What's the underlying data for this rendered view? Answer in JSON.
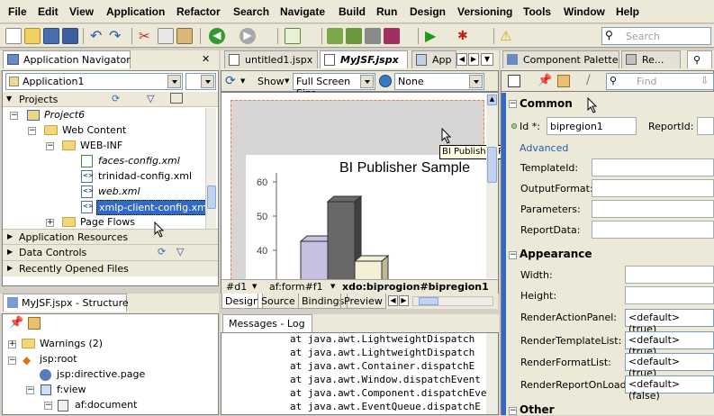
{
  "menu": [
    "File",
    "Edit",
    "View",
    "Application",
    "Refactor",
    "Search",
    "Navigate",
    "Build",
    "Run",
    "Design",
    "Versioning",
    "Tools",
    "Window",
    "Help"
  ],
  "toolbar": {
    "search_placeholder": "Search"
  },
  "app_nav": {
    "tab": "Application Navigator",
    "app": "Application1",
    "projects": "Projects",
    "tree": [
      "Project6",
      "Web Content",
      "WEB-INF",
      "faces-config.xml",
      "trinidad-config.xml",
      "web.xml",
      "xmlp-client-config.xml",
      "Page Flows"
    ],
    "sections": [
      "Application Resources",
      "Data Controls",
      "Recently Opened Files"
    ]
  },
  "editor": {
    "tabs": [
      "untitled1.jspx",
      "MyJSF.jspx",
      "App"
    ],
    "show": "Show",
    "fullscreen": "Full Screen Size",
    "none": "None",
    "chart_title": "BI Publisher Sample",
    "tooltip": "BI Publisher Region",
    "breadcrumb": [
      "#d1",
      "af:form#f1",
      "xdo:biprogion#bipregion1"
    ],
    "bottom_tabs": [
      "Design",
      "Source",
      "Bindings",
      "Preview"
    ]
  },
  "chart_data": {
    "type": "bar",
    "ticks": [
      60,
      50,
      40
    ]
  },
  "structure": {
    "tab": "MyJSF.jspx - Structure",
    "tree": [
      "Warnings (2)",
      "jsp:root",
      "jsp:directive.page",
      "f:view",
      "af:document"
    ]
  },
  "messages": {
    "tab": "Messages - Log",
    "lines": [
      "at java.awt.LightweightDispatch",
      "at java.awt.LightweightDispatch",
      "at java.awt.Container.dispatchE",
      "at java.awt.Window.dispatchEvent",
      "at java.awt.Component.dispatchEve",
      "at java.awt.EventQueue.dispatchE"
    ]
  },
  "palette": {
    "tabs": [
      "Component Palette",
      "Re..."
    ],
    "find_placeholder": "Find",
    "common": "Common",
    "id_label": "Id *:",
    "id_value": "bipregion1",
    "reportid_label": "ReportId:",
    "advanced": "Advanced",
    "adv_props": [
      "TemplateId:",
      "OutputFormat:",
      "Parameters:",
      "ReportData:"
    ],
    "appearance": "Appearance",
    "appear_props": [
      "Width:",
      "Height:",
      "RenderActionPanel:",
      "RenderTemplateList:",
      "RenderFormatList:",
      "RenderReportOnLoad:"
    ],
    "appear_values": [
      "<default> (true)",
      "<default> (true)",
      "<default> (true)",
      "<default> (false)"
    ],
    "other": "Other"
  }
}
